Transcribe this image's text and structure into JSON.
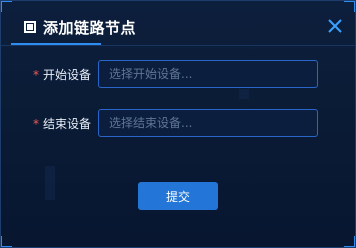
{
  "dialog": {
    "title": "添加链路节点",
    "icons": {
      "title": "square-icon",
      "close": "close-icon"
    }
  },
  "form": {
    "start_device": {
      "required_mark": "*",
      "label": "开始设备",
      "placeholder": "选择开始设备...",
      "value": ""
    },
    "end_device": {
      "required_mark": "*",
      "label": "结束设备",
      "placeholder": "选择结束设备...",
      "value": ""
    }
  },
  "actions": {
    "submit_label": "提交"
  },
  "colors": {
    "accent": "#2f8cf0",
    "background": "#0b1c38",
    "button": "#2376d8",
    "required": "#f05a5a"
  }
}
